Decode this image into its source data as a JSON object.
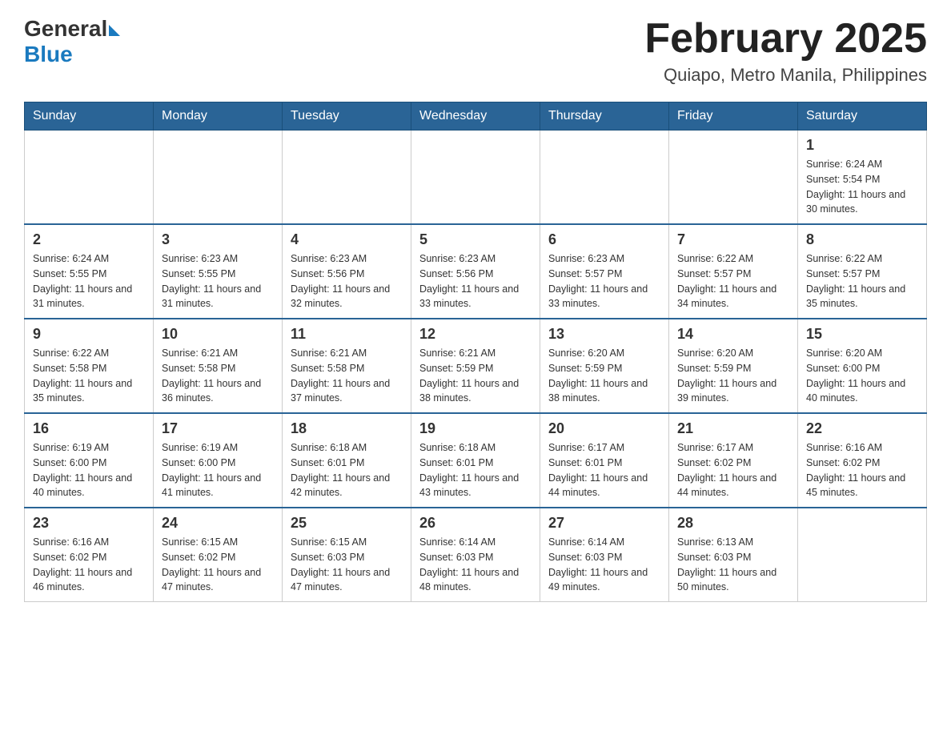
{
  "header": {
    "logo": {
      "general": "General",
      "triangle": "",
      "blue": "Blue"
    },
    "title": "February 2025",
    "subtitle": "Quiapo, Metro Manila, Philippines"
  },
  "days_of_week": [
    "Sunday",
    "Monday",
    "Tuesday",
    "Wednesday",
    "Thursday",
    "Friday",
    "Saturday"
  ],
  "weeks": [
    {
      "days": [
        {
          "num": "",
          "info": ""
        },
        {
          "num": "",
          "info": ""
        },
        {
          "num": "",
          "info": ""
        },
        {
          "num": "",
          "info": ""
        },
        {
          "num": "",
          "info": ""
        },
        {
          "num": "",
          "info": ""
        },
        {
          "num": "1",
          "info": "Sunrise: 6:24 AM\nSunset: 5:54 PM\nDaylight: 11 hours and 30 minutes."
        }
      ]
    },
    {
      "days": [
        {
          "num": "2",
          "info": "Sunrise: 6:24 AM\nSunset: 5:55 PM\nDaylight: 11 hours and 31 minutes."
        },
        {
          "num": "3",
          "info": "Sunrise: 6:23 AM\nSunset: 5:55 PM\nDaylight: 11 hours and 31 minutes."
        },
        {
          "num": "4",
          "info": "Sunrise: 6:23 AM\nSunset: 5:56 PM\nDaylight: 11 hours and 32 minutes."
        },
        {
          "num": "5",
          "info": "Sunrise: 6:23 AM\nSunset: 5:56 PM\nDaylight: 11 hours and 33 minutes."
        },
        {
          "num": "6",
          "info": "Sunrise: 6:23 AM\nSunset: 5:57 PM\nDaylight: 11 hours and 33 minutes."
        },
        {
          "num": "7",
          "info": "Sunrise: 6:22 AM\nSunset: 5:57 PM\nDaylight: 11 hours and 34 minutes."
        },
        {
          "num": "8",
          "info": "Sunrise: 6:22 AM\nSunset: 5:57 PM\nDaylight: 11 hours and 35 minutes."
        }
      ]
    },
    {
      "days": [
        {
          "num": "9",
          "info": "Sunrise: 6:22 AM\nSunset: 5:58 PM\nDaylight: 11 hours and 35 minutes."
        },
        {
          "num": "10",
          "info": "Sunrise: 6:21 AM\nSunset: 5:58 PM\nDaylight: 11 hours and 36 minutes."
        },
        {
          "num": "11",
          "info": "Sunrise: 6:21 AM\nSunset: 5:58 PM\nDaylight: 11 hours and 37 minutes."
        },
        {
          "num": "12",
          "info": "Sunrise: 6:21 AM\nSunset: 5:59 PM\nDaylight: 11 hours and 38 minutes."
        },
        {
          "num": "13",
          "info": "Sunrise: 6:20 AM\nSunset: 5:59 PM\nDaylight: 11 hours and 38 minutes."
        },
        {
          "num": "14",
          "info": "Sunrise: 6:20 AM\nSunset: 5:59 PM\nDaylight: 11 hours and 39 minutes."
        },
        {
          "num": "15",
          "info": "Sunrise: 6:20 AM\nSunset: 6:00 PM\nDaylight: 11 hours and 40 minutes."
        }
      ]
    },
    {
      "days": [
        {
          "num": "16",
          "info": "Sunrise: 6:19 AM\nSunset: 6:00 PM\nDaylight: 11 hours and 40 minutes."
        },
        {
          "num": "17",
          "info": "Sunrise: 6:19 AM\nSunset: 6:00 PM\nDaylight: 11 hours and 41 minutes."
        },
        {
          "num": "18",
          "info": "Sunrise: 6:18 AM\nSunset: 6:01 PM\nDaylight: 11 hours and 42 minutes."
        },
        {
          "num": "19",
          "info": "Sunrise: 6:18 AM\nSunset: 6:01 PM\nDaylight: 11 hours and 43 minutes."
        },
        {
          "num": "20",
          "info": "Sunrise: 6:17 AM\nSunset: 6:01 PM\nDaylight: 11 hours and 44 minutes."
        },
        {
          "num": "21",
          "info": "Sunrise: 6:17 AM\nSunset: 6:02 PM\nDaylight: 11 hours and 44 minutes."
        },
        {
          "num": "22",
          "info": "Sunrise: 6:16 AM\nSunset: 6:02 PM\nDaylight: 11 hours and 45 minutes."
        }
      ]
    },
    {
      "days": [
        {
          "num": "23",
          "info": "Sunrise: 6:16 AM\nSunset: 6:02 PM\nDaylight: 11 hours and 46 minutes."
        },
        {
          "num": "24",
          "info": "Sunrise: 6:15 AM\nSunset: 6:02 PM\nDaylight: 11 hours and 47 minutes."
        },
        {
          "num": "25",
          "info": "Sunrise: 6:15 AM\nSunset: 6:03 PM\nDaylight: 11 hours and 47 minutes."
        },
        {
          "num": "26",
          "info": "Sunrise: 6:14 AM\nSunset: 6:03 PM\nDaylight: 11 hours and 48 minutes."
        },
        {
          "num": "27",
          "info": "Sunrise: 6:14 AM\nSunset: 6:03 PM\nDaylight: 11 hours and 49 minutes."
        },
        {
          "num": "28",
          "info": "Sunrise: 6:13 AM\nSunset: 6:03 PM\nDaylight: 11 hours and 50 minutes."
        },
        {
          "num": "",
          "info": ""
        }
      ]
    }
  ]
}
